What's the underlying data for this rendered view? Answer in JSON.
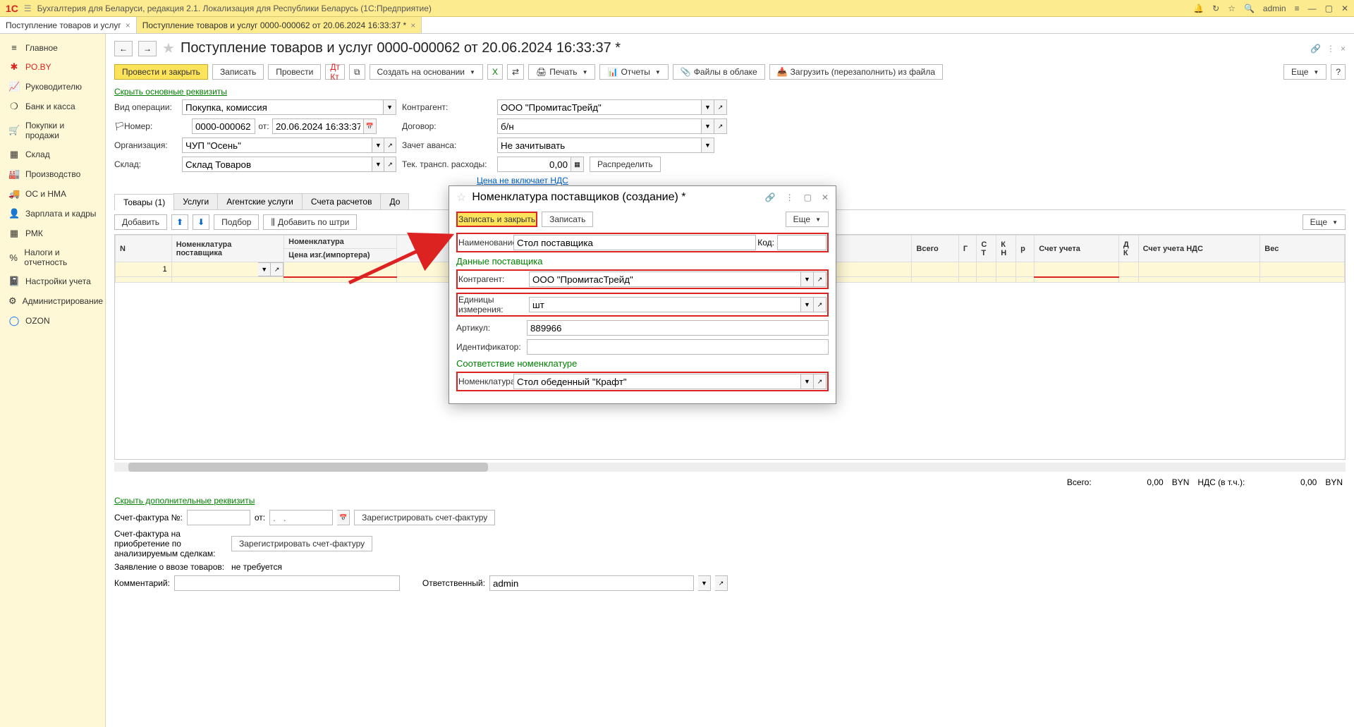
{
  "titlebar": {
    "logo": "1С",
    "title": "Бухгалтерия для Беларуси, редакция 2.1. Локализация для Республики Беларусь   (1С:Предприятие)",
    "user": "admin"
  },
  "tabs": [
    {
      "label": "Поступление товаров и услуг",
      "active": false
    },
    {
      "label": "Поступление товаров и услуг 0000-000062 от 20.06.2024 16:33:37 *",
      "active": true
    }
  ],
  "sidebar": {
    "items": [
      {
        "icon": "≡",
        "label": "Главное"
      },
      {
        "icon": "✱",
        "label": "PO.BY"
      },
      {
        "icon": "📈",
        "label": "Руководителю"
      },
      {
        "icon": "❍",
        "label": "Банк и касса"
      },
      {
        "icon": "🛒",
        "label": "Покупки и продажи"
      },
      {
        "icon": "▦",
        "label": "Склад"
      },
      {
        "icon": "🏭",
        "label": "Производство"
      },
      {
        "icon": "🚚",
        "label": "ОС и НМА"
      },
      {
        "icon": "👤",
        "label": "Зарплата и кадры"
      },
      {
        "icon": "▦",
        "label": "РМК"
      },
      {
        "icon": "%",
        "label": "Налоги и отчетность"
      },
      {
        "icon": "📓",
        "label": "Настройки учета"
      },
      {
        "icon": "⚙",
        "label": "Администрирование"
      },
      {
        "icon": "◯",
        "label": "OZON"
      }
    ]
  },
  "doc": {
    "title": "Поступление товаров и услуг 0000-000062 от 20.06.2024 16:33:37 *",
    "toolbar": {
      "post_close": "Провести и закрыть",
      "save": "Записать",
      "post": "Провести",
      "create_based": "Создать на основании",
      "print": "Печать",
      "reports": "Отчеты",
      "files": "Файлы в облаке",
      "load_file": "Загрузить (перезаполнить) из файла",
      "more": "Еще"
    },
    "hide_props": "Скрыть основные реквизиты",
    "fields": {
      "op_type_lbl": "Вид операции:",
      "op_type": "Покупка, комиссия",
      "number_lbl": "Номер:",
      "number": "0000-000062",
      "from_lbl": "от:",
      "date": "20.06.2024 16:33:37",
      "org_lbl": "Организация:",
      "org": "ЧУП \"Осень\"",
      "warehouse_lbl": "Склад:",
      "warehouse": "Склад Товаров",
      "counterparty_lbl": "Контрагент:",
      "counterparty": "ООО \"ПромитасТрейд\"",
      "contract_lbl": "Договор:",
      "contract": "б/н",
      "advance_lbl": "Зачет аванса:",
      "advance": "Не зачитывать",
      "transport_lbl": "Тек. трансп. расходы:",
      "transport": "0,00",
      "distribute": "Распределить",
      "price_vat": "Цена не включает НДС"
    },
    "subtabs": {
      "goods": "Товары (1)",
      "services": "Услуги",
      "agent": "Агентские услуги",
      "accounts": "Счета расчетов",
      "additional": "До"
    },
    "tbl_toolbar": {
      "add": "Добавить",
      "pick": "Подбор",
      "add_barcode": "Добавить по штри",
      "more": "Еще"
    },
    "table": {
      "headers": {
        "n": "N",
        "supplier_nom": "Номенклатура поставщика",
        "nom": "Номенклатура",
        "import_price": "Цена изг.(импортера)",
        "total": "Всего",
        "acct": "Счет учета",
        "vat_acct": "Счет учета НДС",
        "weight": "Вес"
      },
      "rows": [
        {
          "n": "1"
        }
      ]
    },
    "totals": {
      "total_lbl": "Всего:",
      "total_val": "0,00",
      "cur1": "BYN",
      "vat_lbl": "НДС (в т.ч.):",
      "vat_val": "0,00",
      "cur2": "BYN"
    },
    "hide_additional": "Скрыть дополнительные реквизиты",
    "bottom": {
      "invoice_lbl": "Счет-фактура №:",
      "from_lbl": "от:",
      "date_placeholder": ".   .",
      "register1": "Зарегистрировать счет-фактуру",
      "invoice_analyzed": "Счет-фактура на приобретение по анализируемым сделкам:",
      "register2": "Зарегистрировать счет-фактуру",
      "import_decl_lbl": "Заявление о ввозе товаров:",
      "import_decl_val": "не требуется",
      "comment_lbl": "Комментарий:",
      "responsible_lbl": "Ответственный:",
      "responsible": "admin"
    }
  },
  "modal": {
    "title": "Номенклатура поставщиков (создание) *",
    "save_close": "Записать и закрыть",
    "save": "Записать",
    "more": "Еще",
    "name_lbl": "Наименование:",
    "name_val": "Стол поставщика",
    "code_lbl": "Код:",
    "supplier_section": "Данные поставщика",
    "counterparty_lbl": "Контрагент:",
    "counterparty_val": "ООО \"ПромитасТрейд\"",
    "unit_lbl": "Единицы измерения:",
    "unit_val": "шт",
    "article_lbl": "Артикул:",
    "article_val": "889966",
    "id_lbl": "Идентификатор:",
    "match_section": "Соответствие номенклатуре",
    "nom_lbl": "Номенклатура:",
    "nom_val": "Стол обеденный \"Крафт\""
  }
}
